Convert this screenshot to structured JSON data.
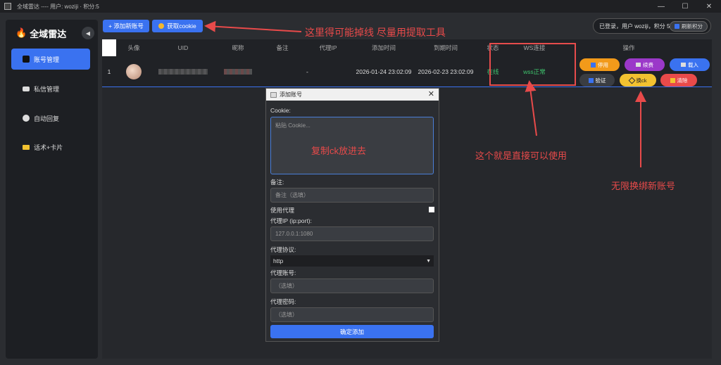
{
  "window": {
    "title": "全域雷达 ---- 用户: woziji · 积分:5",
    "minimize": "—",
    "maximize": "☐",
    "close": "✕"
  },
  "sidebar": {
    "logo": "全域雷达",
    "collapse": "◀",
    "items": [
      {
        "label": "账号管理",
        "active": true
      },
      {
        "label": "私信管理",
        "active": false
      },
      {
        "label": "自动回复",
        "active": false
      },
      {
        "label": "话术+卡片",
        "active": false
      }
    ]
  },
  "toolbar": {
    "add_account": "+ 添加新账号",
    "get_cookie": "获取cookie"
  },
  "status": {
    "text": "已登录，用户 woziji，积分 5",
    "refresh": "刷新积分"
  },
  "table": {
    "headers": [
      "头像",
      "UID",
      "昵称",
      "备注",
      "代理IP",
      "添加时间",
      "到期时间",
      "状态",
      "WS连接",
      "操作"
    ],
    "rows": [
      {
        "index": "1",
        "proxy": "-",
        "added": "2026-01-24 23:02:09",
        "expires": "2026-02-23 23:02:09",
        "state": "在线",
        "ws": "wss正常"
      }
    ],
    "actions": [
      "停用",
      "续费",
      "载入",
      "验证",
      "换ck",
      "清除"
    ]
  },
  "dialog": {
    "title": "添加账号",
    "close": "✕",
    "cookie_label": "Cookie:",
    "cookie_placeholder": "粘贴 Cookie...",
    "note_label": "备注:",
    "note_placeholder": "备注（选填）",
    "use_proxy_label": "使用代理",
    "proxy_ip_label": "代理IP (ip:port):",
    "proxy_ip_placeholder": "127.0.0.1:1080",
    "protocol_label": "代理协议:",
    "protocol_value": "http",
    "proxy_user_label": "代理账号:",
    "proxy_user_placeholder": "（选填）",
    "proxy_pass_label": "代理密码:",
    "proxy_pass_placeholder": "（选填）",
    "submit": "确定添加"
  },
  "annotations": {
    "cookie_tip": "这里得可能掉线 尽量用提取工具",
    "paste_tip": "复制ck放进去",
    "direct_use": "这个就是直接可以使用",
    "rebind": "无限换绑新账号"
  },
  "colors": {
    "accent": "#3a72f0",
    "annotation": "#e84a4a",
    "online": "#3ec46d"
  }
}
